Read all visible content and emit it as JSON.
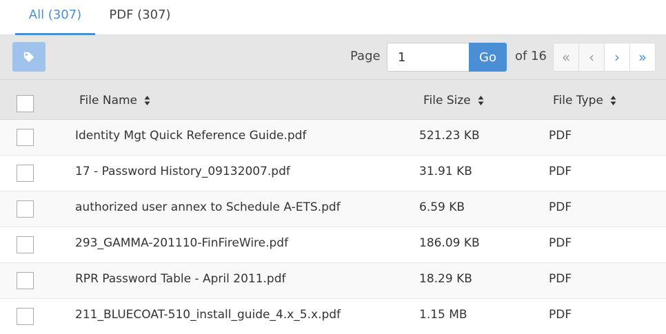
{
  "tabs": [
    {
      "label": "All (307)",
      "active": true
    },
    {
      "label": "PDF (307)",
      "active": false
    }
  ],
  "toolbar": {
    "tag_icon": "tag-icon",
    "page_label": "Page",
    "page_value": "1",
    "go_label": "Go",
    "of_label": "of 16",
    "pager": {
      "first": "«",
      "prev": "‹",
      "next": "›",
      "last": "»"
    }
  },
  "table": {
    "columns": [
      "File Name",
      "File Size",
      "File Type"
    ],
    "rows": [
      {
        "name": "Identity Mgt Quick Reference Guide.pdf",
        "size": "521.23 KB",
        "type": "PDF"
      },
      {
        "name": "17 - Password History_09132007.pdf",
        "size": "31.91 KB",
        "type": "PDF"
      },
      {
        "name": "authorized user annex to Schedule A-ETS.pdf",
        "size": "6.59 KB",
        "type": "PDF"
      },
      {
        "name": "293_GAMMA-201110-FinFireWire.pdf",
        "size": "186.09 KB",
        "type": "PDF"
      },
      {
        "name": "RPR Password Table - April 2011.pdf",
        "size": "18.29 KB",
        "type": "PDF"
      },
      {
        "name": "211_BLUECOAT-510_install_guide_4.x_5.x.pdf",
        "size": "1.15 MB",
        "type": "PDF"
      }
    ]
  },
  "colors": {
    "accent": "#4a8fd6",
    "tag_button": "#9fc3ec",
    "toolbar_bg": "#e6e6e6"
  }
}
